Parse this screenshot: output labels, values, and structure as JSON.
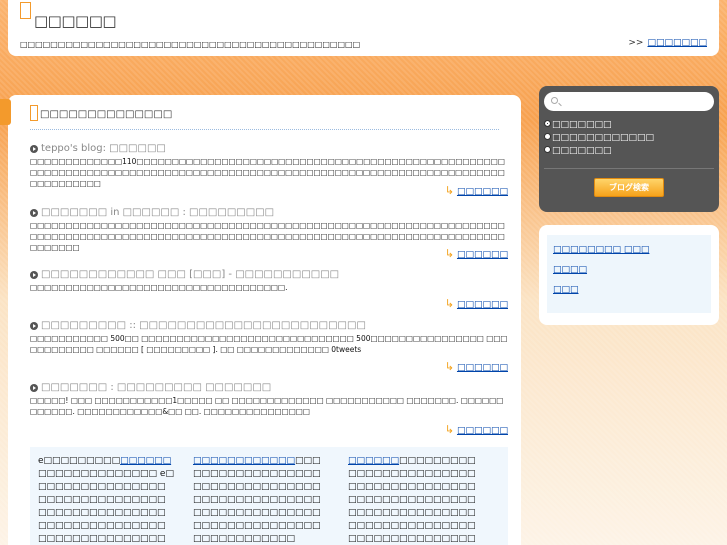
{
  "header": {
    "title": "□□□□□□",
    "description": "□□□□□□□□□□□□□□□□□□□□□□□□□□□□□□□□□□□□□□□□□□□□□",
    "link_prefix": ">>",
    "link_label": "□□□□□□□"
  },
  "main": {
    "title": "□□□□□□□□□□□□□□",
    "entries": [
      {
        "title": "teppo's blog: □□□□□□",
        "body": "□□□□□□□□□□□□□110□□□□□□□□□□□□□□□□□□□□□□□□□□□□□□□□□□□□□□□□□□□□□□□□□□□□□□□□□□□□□□□□□□□□□□□□□□□□□□□□□□□□□□□□□□□□□□□□□□□□□□□□□□□□□□□□□□□□□□□□□□□□□□□□□",
        "more": "□□□□□□"
      },
      {
        "title": "□□□□□□□ in □□□□□□ : □□□□□□□□□",
        "body": "□□□□□□□□□□□□□□□□□□□□□□□□□□□□□□□□□□□□□□□□□□□□□□□□□□□□□□□□□□□□□□□□□□□□□□□□□□□□□□□□□□□□□□□□□□□□□□□□□□□□□□□□□□□□□□□□□□□□□□□□□□□□□□□□□□□□□□□□□□□□□",
        "more": "□□□□□□"
      },
      {
        "title": "□□□□□□□□□□□□ □□□ [□□□] - □□□□□□□□□□□",
        "body": "□□□□□□□□□□□□□□□□□□□□□□□□□□□□□□□□□□□□.",
        "more": "□□□□□□"
      },
      {
        "title": "□□□□□□□□□ :: □□□□□□□□□□□□□□□□□□□□□□□□",
        "body": "□□□□□□□□□□□ 500□□ □□□□□□□□□□□□□□□□□□□□□□□□□□□□□□ 500□□□□□□□□□□□□□□□□ □□□□□□□□□□□□ □□□□□□ [ □□□□□□□□□ ]. □□ □□□□□□□□□□□□□ 0tweets",
        "more": "□□□□□□"
      },
      {
        "title": "□□□□□□□ : □□□□□□□□□ □□□□□□□",
        "body": "□□□□□! □□□ □□□□□□□□□□□1□□□□□ □□ □□□□□□□□□□□□□ □□□□□□□□□□□ □□□□□□□. □□□□□□□□□□□□. □□□□□□□□□□□□&□□ □□. □□□□□□□□□□□□□□□",
        "more": "□□□□□□"
      }
    ],
    "links_box": {
      "col1_pre": "e□□□□□□□□□",
      "col1_link": "□□□□□□",
      "col1_post": "□□□□□□□□□□□□□□ e□□□□□□□□□□□□□□□□□□□□□□□□□□□□□□□□□□□□□□□□□□□□□□□□□□□□□□□□□□□□□□□□□□□□□□□□□□□□□□□□□□□□□□□□□□□□□□□□□",
      "col2_link": "□□□□□□□□□□□□",
      "col2_post": "□□□□□□□□□□□□□□□□□□□□□□□□□□□□□□□□□□□□□□□□□□□□□□□□□□□□□□□□□□□□□□□□□□□□□□□□□□□□□□□□□□□□□□□□□□",
      "col3_link": "□□□□□□",
      "col3_post": "□□□□□□□□□□□□□□□□□□□□□□□□□□□□□□□□□□□□□□□□□□□□□□□□□□□□□□□□□□□□□□□□□□□□□□□□□□□□□□□□□□□□□□□□□□□□□□□□□□□□□□□□□□□□□□□"
    }
  },
  "search": {
    "placeholder": "",
    "options": [
      "□□□□□□□",
      "□□□□□□□□□□□□",
      "□□□□□□□"
    ],
    "button_label": "ブログ検索"
  },
  "side_links": [
    "□□□□□□□□ □□□",
    "□□□□",
    "□□□"
  ],
  "colors": {
    "accent": "#f39a2c",
    "link": "#0044aa",
    "panel": "#555555"
  }
}
